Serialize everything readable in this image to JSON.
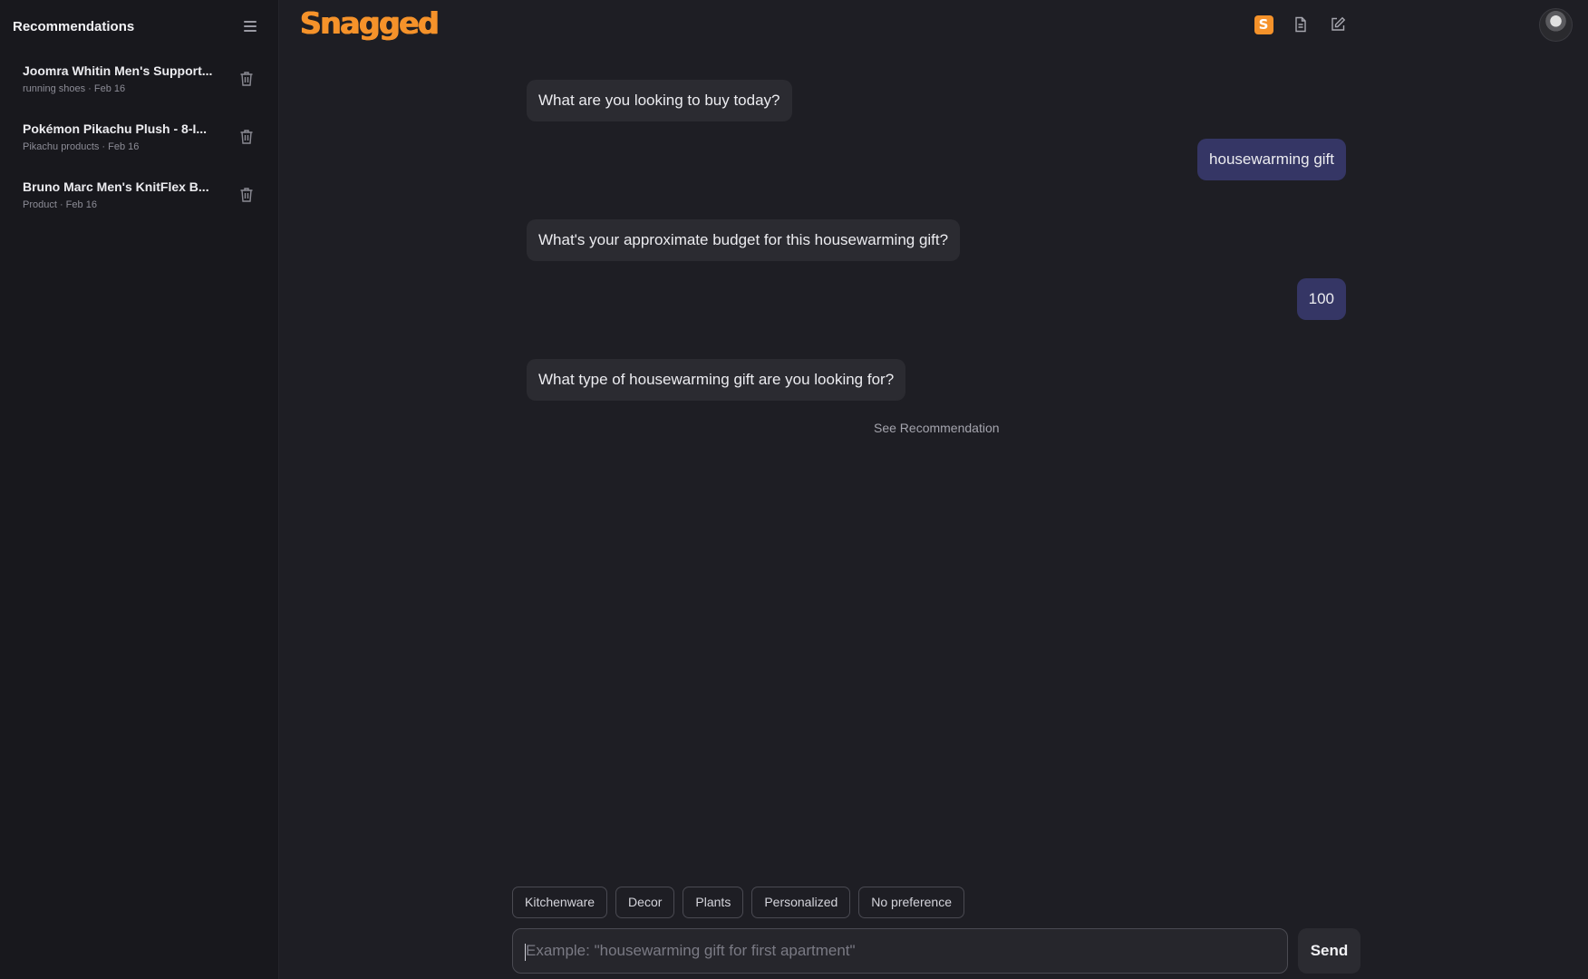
{
  "sidebar": {
    "title": "Recommendations",
    "items": [
      {
        "title": "Joomra Whitin Men's Support...",
        "meta": "running shoes · Feb 16"
      },
      {
        "title": "Pokémon Pikachu Plush - 8-I...",
        "meta": "Pikachu products · Feb 16"
      },
      {
        "title": "Bruno Marc Men's KnitFlex B...",
        "meta": "Product · Feb 16"
      }
    ]
  },
  "header": {
    "logo": "Snagged",
    "badge_letter": "S"
  },
  "chat": {
    "messages": [
      {
        "role": "bot",
        "text": "What are you looking to buy today?"
      },
      {
        "role": "user",
        "text": "housewarming gift"
      },
      {
        "role": "bot",
        "text": "What's your approximate budget for this housewarming gift?"
      },
      {
        "role": "user",
        "text": "100"
      },
      {
        "role": "bot",
        "text": "What type of housewarming gift are you looking for?"
      }
    ],
    "see_recommendation": "See Recommendation"
  },
  "composer": {
    "chips": [
      "Kitchenware",
      "Decor",
      "Plants",
      "Personalized",
      "No preference"
    ],
    "placeholder": "Example: \"housewarming gift for first apartment\"",
    "value": "",
    "send_label": "Send"
  },
  "colors": {
    "accent": "#f5922a",
    "user_bubble": "#353665",
    "bot_bubble": "#2b2b31",
    "background": "#1e1e24",
    "sidebar": "#18181d"
  },
  "icons": {
    "menu": "hamburger-icon",
    "delete": "trash-icon",
    "document": "document-icon",
    "new_chat": "edit-icon"
  }
}
